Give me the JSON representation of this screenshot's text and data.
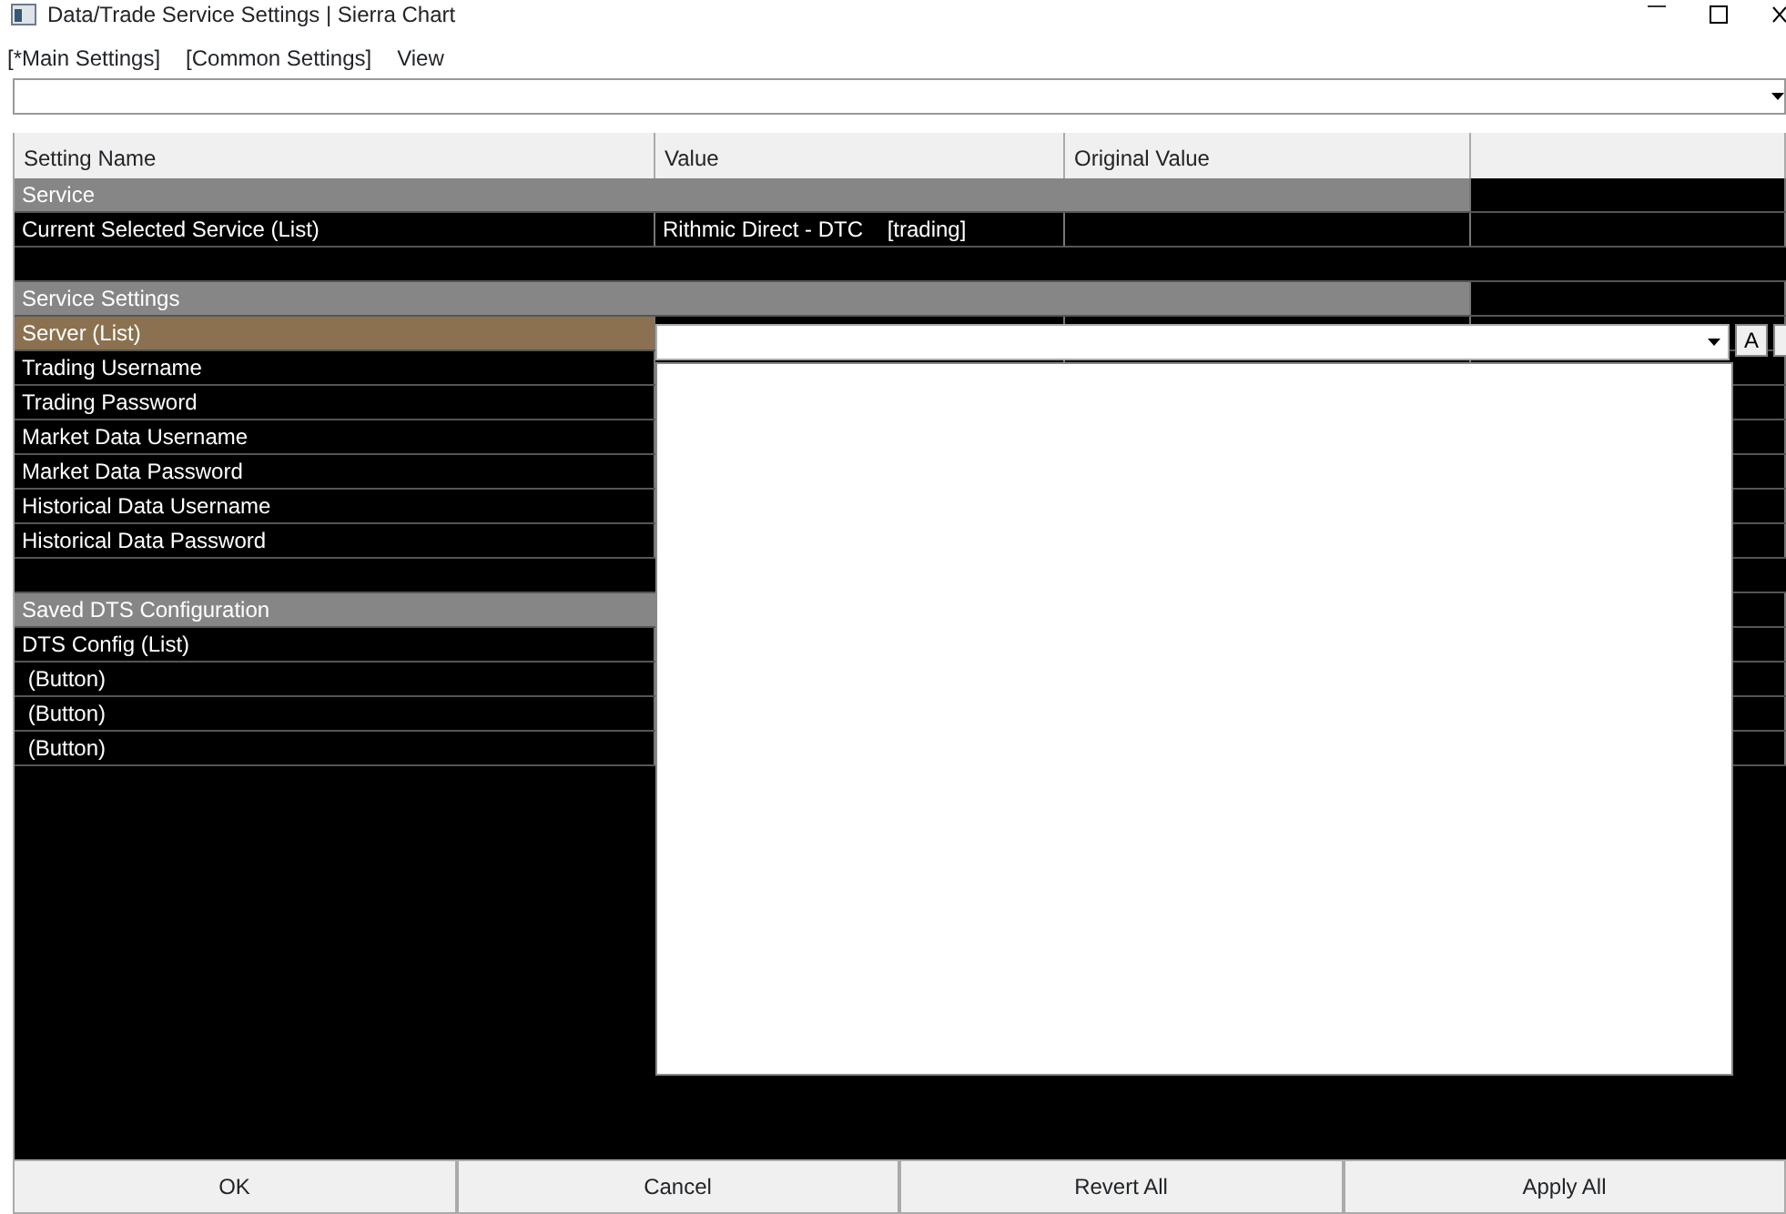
{
  "window": {
    "title": "Data/Trade Service Settings | Sierra Chart"
  },
  "menu": [
    {
      "label": "[*Main Settings]"
    },
    {
      "label": "[Common Settings]"
    },
    {
      "label": "View"
    }
  ],
  "table": {
    "columns": [
      "Setting Name",
      "Value",
      "Original Value"
    ],
    "rows": [
      {
        "kind": "group",
        "name": "Service"
      },
      {
        "kind": "setting",
        "name": "Current Selected Service (List)",
        "value": "Rithmic Direct - DTC    [trading]",
        "selected": false
      },
      {
        "kind": "blank"
      },
      {
        "kind": "group",
        "name": "Service Settings"
      },
      {
        "kind": "setting",
        "name": "Server (List)",
        "selected": true,
        "editor": {
          "open": true
        }
      },
      {
        "kind": "setting",
        "name": "Trading Username",
        "selected": false
      },
      {
        "kind": "setting",
        "name": "Trading Password",
        "selected": false
      },
      {
        "kind": "setting",
        "name": "Market Data Username",
        "selected": false
      },
      {
        "kind": "setting",
        "name": "Market Data Password",
        "selected": false
      },
      {
        "kind": "setting",
        "name": "Historical Data Username",
        "selected": false
      },
      {
        "kind": "setting",
        "name": "Historical Data Password",
        "selected": false
      },
      {
        "kind": "blank"
      },
      {
        "kind": "group",
        "name": "Saved DTS Configuration"
      },
      {
        "kind": "setting",
        "name": "DTS Config (List)",
        "selected": false
      },
      {
        "kind": "setting",
        "name": " (Button)",
        "selected": false
      },
      {
        "kind": "setting",
        "name": " (Button)",
        "selected": false
      },
      {
        "kind": "setting",
        "name": " (Button)",
        "selected": false
      }
    ]
  },
  "editor_button": {
    "label": "A"
  },
  "buttons": [
    {
      "label": "OK"
    },
    {
      "label": "Cancel"
    },
    {
      "label": "Revert All"
    },
    {
      "label": "Apply All"
    }
  ]
}
